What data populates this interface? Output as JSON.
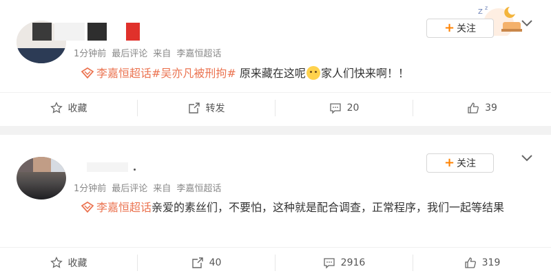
{
  "posts": [
    {
      "time": "1分钟前",
      "meta_source_label": "最后评论",
      "meta_from": "来自",
      "meta_source": "李嘉恒超话",
      "follow_label": "关注",
      "topic_tag": "李嘉恒超话",
      "hashtag": "#吴亦凡被刑拘#",
      "text_before_emoji": " 原来藏在这呢",
      "text_after_emoji": "家人们快来啊！！",
      "actions": {
        "favorite_label": "收藏",
        "repost_label": "转发",
        "comments": "20",
        "likes": "39"
      }
    },
    {
      "time": "1分钟前",
      "meta_source_label": "最后评论",
      "meta_from": "来自",
      "meta_source": "李嘉恒超话",
      "follow_label": "关注",
      "topic_tag": "李嘉恒超话",
      "text": "亲爱的素丝们，不要怕，这种就是配合调查，正常程序，我们一起等结果",
      "actions": {
        "favorite_label": "收藏",
        "reposts": "40",
        "comments": "2916",
        "likes": "319"
      }
    }
  ],
  "colors": {
    "accent": "#ff8200",
    "topic": "#eb7350",
    "meta": "#888888",
    "separator": "#f2f2f2"
  },
  "icons": [
    "star-icon",
    "repost-icon",
    "comment-icon",
    "thumbs-up-icon",
    "chevron-down-icon",
    "super-topic-icon"
  ]
}
